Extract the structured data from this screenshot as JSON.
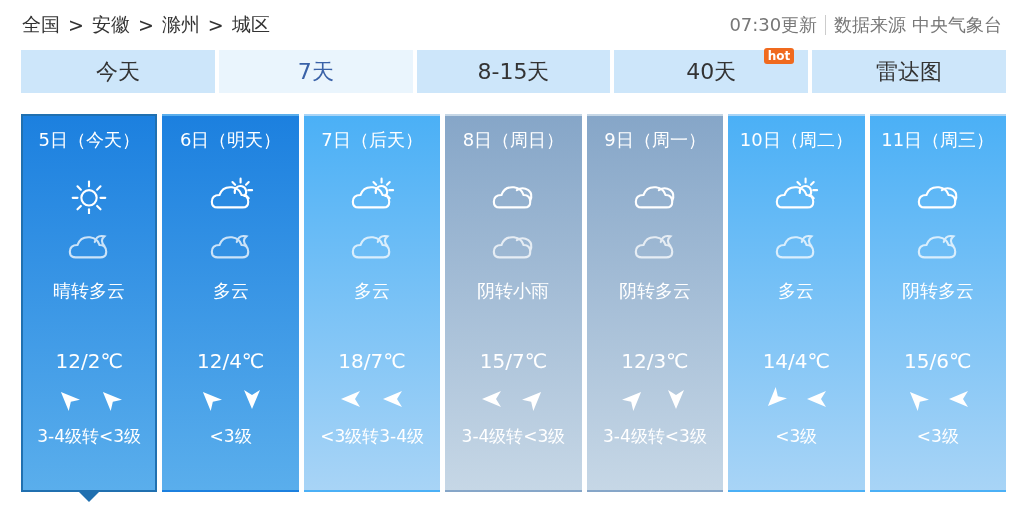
{
  "breadcrumb": [
    "全国",
    "安徽",
    "滁州",
    "城区"
  ],
  "breadcrumb_separator": ">",
  "update_time": "07:30更新",
  "source": "数据来源 中央气象台",
  "tabs": [
    {
      "label": "今天",
      "selected": false
    },
    {
      "label": "7天",
      "selected": true
    },
    {
      "label": "8-15天",
      "selected": false
    },
    {
      "label": "40天",
      "selected": false,
      "badge": "hot"
    },
    {
      "label": "雷达图",
      "selected": false
    }
  ],
  "days": [
    {
      "date": "5日（今天）",
      "selected": true,
      "kind": "deep",
      "weather": "晴转多云",
      "temperature": "12/2℃",
      "wind": "3-4级转<3级"
    },
    {
      "date": "6日（明天）",
      "selected": false,
      "kind": "deep",
      "weather": "多云",
      "temperature": "12/4℃",
      "wind": "<3级"
    },
    {
      "date": "7日（后天）",
      "selected": false,
      "kind": "blue",
      "weather": "多云",
      "temperature": "18/7℃",
      "wind": "<3级转3-4级"
    },
    {
      "date": "8日（周日）",
      "selected": false,
      "kind": "gray",
      "weather": "阴转小雨",
      "temperature": "15/7℃",
      "wind": "3-4级转<3级"
    },
    {
      "date": "9日（周一）",
      "selected": false,
      "kind": "gray",
      "weather": "阴转多云",
      "temperature": "12/3℃",
      "wind": "3-4级转<3级"
    },
    {
      "date": "10日（周二）",
      "selected": false,
      "kind": "blue",
      "weather": "多云",
      "temperature": "14/4℃",
      "wind": "<3级"
    },
    {
      "date": "11日（周三）",
      "selected": false,
      "kind": "blue",
      "weather": "阴转多云",
      "temperature": "15/6℃",
      "wind": "<3级"
    }
  ]
}
